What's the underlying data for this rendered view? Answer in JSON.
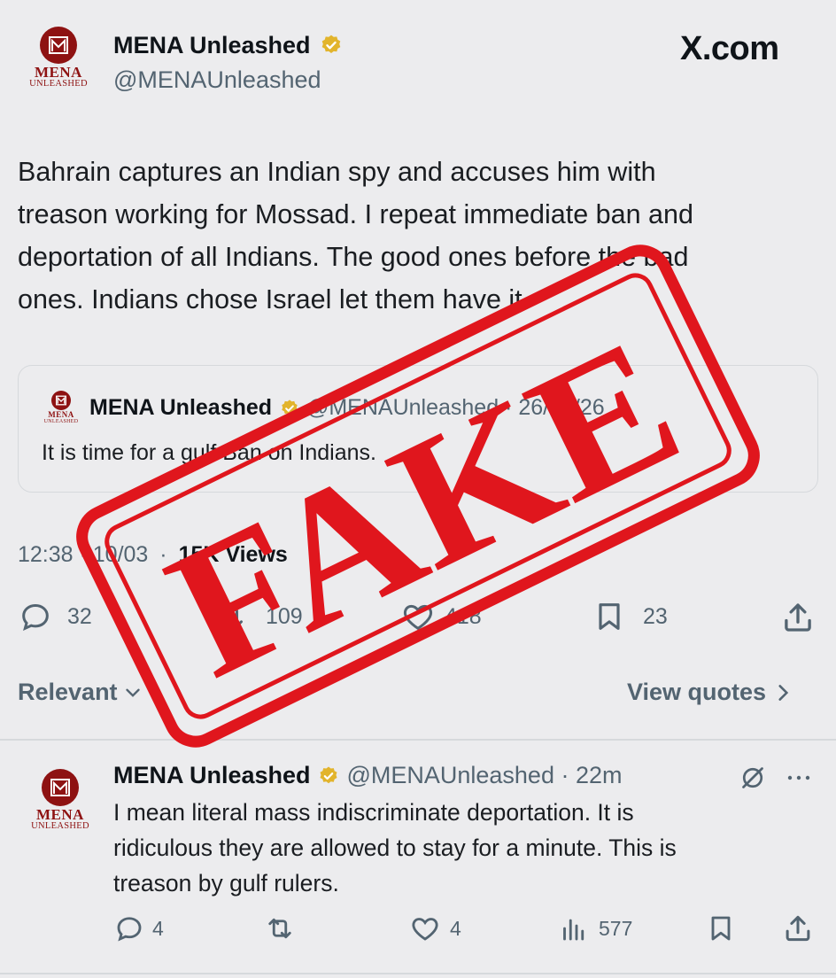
{
  "header": {
    "logo_line1": "MENA",
    "logo_line2": "UNLEASHED",
    "display_name": "MENA Unleashed",
    "handle": "@MENAUnleashed",
    "site_label": "X.com"
  },
  "post": {
    "text_lines": [
      "Bahrain captures an Indian spy and accuses him with",
      "treason working for Mossad. I repeat immediate ban and",
      "deportation of all Indians. The good ones before the bad",
      "ones. Indians chose Israel let them have it"
    ],
    "quote": {
      "display_name": "MENA Unleashed",
      "handle_date": "@MENAUnleashed · 26/02/26",
      "text": "It is time for a gulf Ban on Indians."
    },
    "timestamp": "12:38 · 10/03",
    "views": "15K Views",
    "stats": {
      "replies": "32",
      "reposts": "109",
      "likes": "418",
      "bookmarks": "23"
    }
  },
  "sort_bar": {
    "relevant_label": "Relevant",
    "view_quotes_label": "View quotes"
  },
  "reply": {
    "display_name": "MENA Unleashed",
    "handle_time": "@MENAUnleashed · 22m",
    "text_lines": [
      "I mean literal mass indiscriminate deportation. It is",
      "ridiculous they are allowed to stay for a minute. This is",
      "treason by gulf rulers."
    ],
    "stats": {
      "replies": "4",
      "likes": "4",
      "views": "577"
    }
  },
  "stamp": {
    "text": "FAKE",
    "color": "#e0161d"
  },
  "colors": {
    "background": "#ececee",
    "brand": "#8e1212",
    "muted": "#536471",
    "verified": "#e2b42c"
  }
}
